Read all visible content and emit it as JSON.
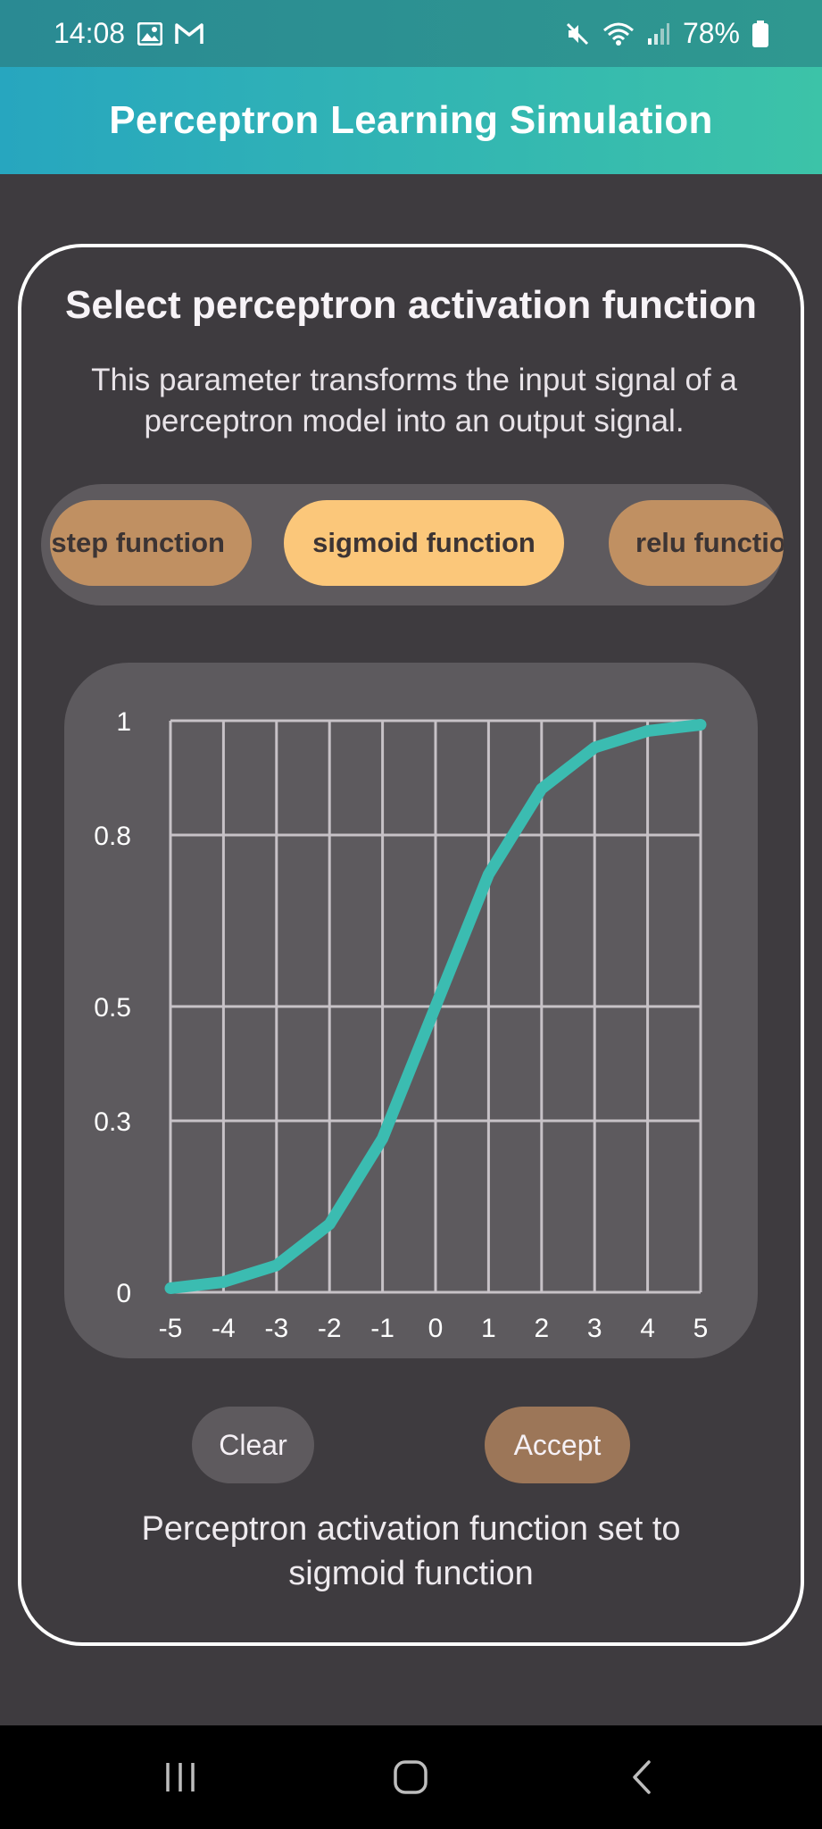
{
  "status": {
    "time": "14:08",
    "battery": "78%",
    "icons": [
      "gallery-icon",
      "gmail-icon",
      "mute-icon",
      "wifi-icon",
      "signal-icon",
      "battery-icon"
    ]
  },
  "app": {
    "title": "Perceptron Learning Simulation"
  },
  "card": {
    "title": "Select perceptron activation function",
    "description": "This parameter transforms the input signal of a perceptron model into an output signal."
  },
  "selector": {
    "options": [
      "step function",
      "sigmoid function",
      "relu functio"
    ],
    "selected": "sigmoid function"
  },
  "chart_data": {
    "type": "line",
    "title": "",
    "xlabel": "",
    "ylabel": "",
    "xlim": [
      -5,
      5
    ],
    "ylim": [
      0,
      1
    ],
    "x_ticks": [
      "-5",
      "-4",
      "-3",
      "-2",
      "-1",
      "0",
      "1",
      "2",
      "3",
      "4",
      "5"
    ],
    "y_ticks": [
      "0",
      "0.3",
      "0.5",
      "0.8",
      "1"
    ],
    "grid": true,
    "series": [
      {
        "x": [
          -5,
          -4,
          -3,
          -2,
          -1,
          0,
          1,
          2,
          3,
          4,
          5
        ],
        "y": [
          0.007,
          0.018,
          0.047,
          0.119,
          0.269,
          0.5,
          0.731,
          0.881,
          0.953,
          0.982,
          0.993
        ],
        "color": "#3bbcb1"
      }
    ]
  },
  "buttons": {
    "clear": "Clear",
    "accept": "Accept"
  },
  "result": {
    "line1": "Perceptron activation function set to",
    "line2": "sigmoid function"
  },
  "colors": {
    "accent": "#3bbcb1",
    "selected_pill": "#fbc77a",
    "pill": "#c09062",
    "accept": "#9c7658"
  }
}
